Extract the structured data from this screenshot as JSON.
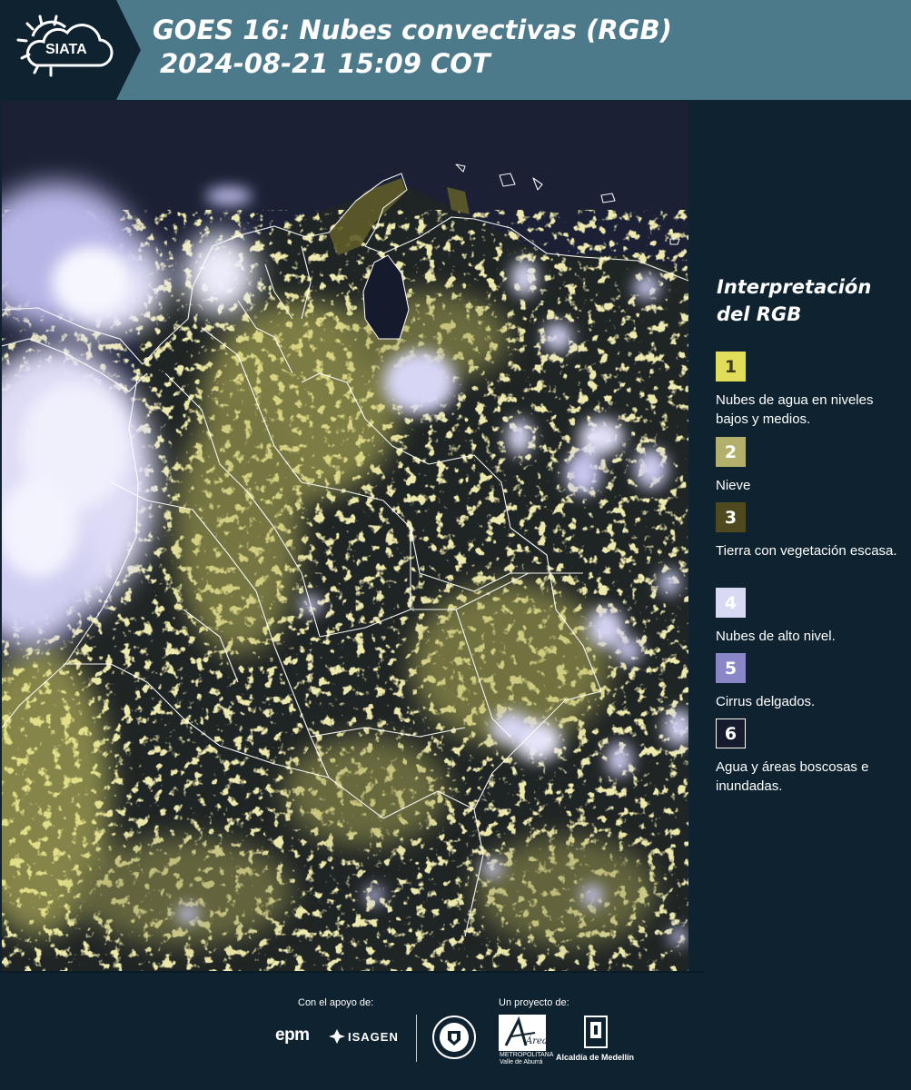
{
  "header": {
    "logo_text": "SIATA",
    "title_line1": "GOES 16: Nubes convectivas (RGB)",
    "title_line2": "2024-08-21 15:09 COT"
  },
  "legend": {
    "title_line1": "Interpretación",
    "title_line2": "del RGB",
    "items": [
      {
        "number": "1",
        "label": "Nubes de agua en niveles bajos y medios.",
        "color": "#e2dd58",
        "text_color": "#3b3a1b"
      },
      {
        "number": "2",
        "label": "Nieve",
        "color": "#b3b06b",
        "text_color": "#ffffff"
      },
      {
        "number": "3",
        "label": "Tierra con vegetación escasa.",
        "color": "#4e4a1d",
        "text_color": "#ffffff"
      },
      {
        "number": "4",
        "label": "Nubes de alto nivel.",
        "color": "#d8daf4",
        "text_color": "#ffffff"
      },
      {
        "number": "5",
        "label": "Cirrus delgados.",
        "color": "#8a87c6",
        "text_color": "#ffffff"
      },
      {
        "number": "6",
        "label": "Agua y áreas boscosas e inundadas.",
        "color": "#161b2d",
        "text_color": "#ffffff"
      }
    ]
  },
  "footer": {
    "support_label": "Con el apoyo de:",
    "project_label": "Un proyecto de:",
    "sponsor_1": "epm",
    "sponsor_2": "ISAGEN",
    "partner_1": "Área",
    "partner_1_sub": "METROPOLITANA Valle de Aburrá",
    "partner_2": "Alcaldía de Medellín"
  },
  "colors": {
    "header_bg": "#4c7a8b",
    "panel_bg": "#0e2230",
    "map_bg": "#1c2235",
    "low_cloud": "#d8d56a",
    "high_cloud": "#dcdcf6",
    "border_line": "#ffffff"
  }
}
